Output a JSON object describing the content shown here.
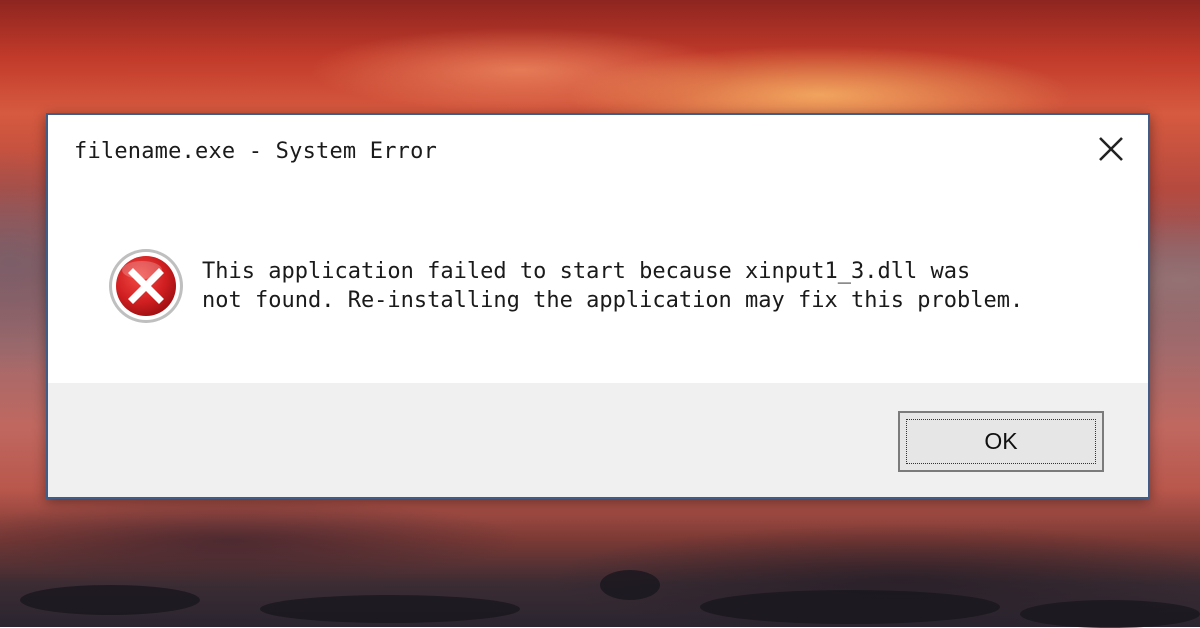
{
  "dialog": {
    "title": "filename.exe - System Error",
    "message_line1": "This application failed to start because xinput1_3.dll was",
    "message_line2": "not found. Re-installing the application may fix this problem.",
    "icon": "error-icon",
    "ok_label": "OK",
    "close_icon": "close-icon"
  },
  "colors": {
    "error_red": "#c8191b",
    "footer_bg": "#f0f0f0",
    "border": "#3f5d86"
  }
}
